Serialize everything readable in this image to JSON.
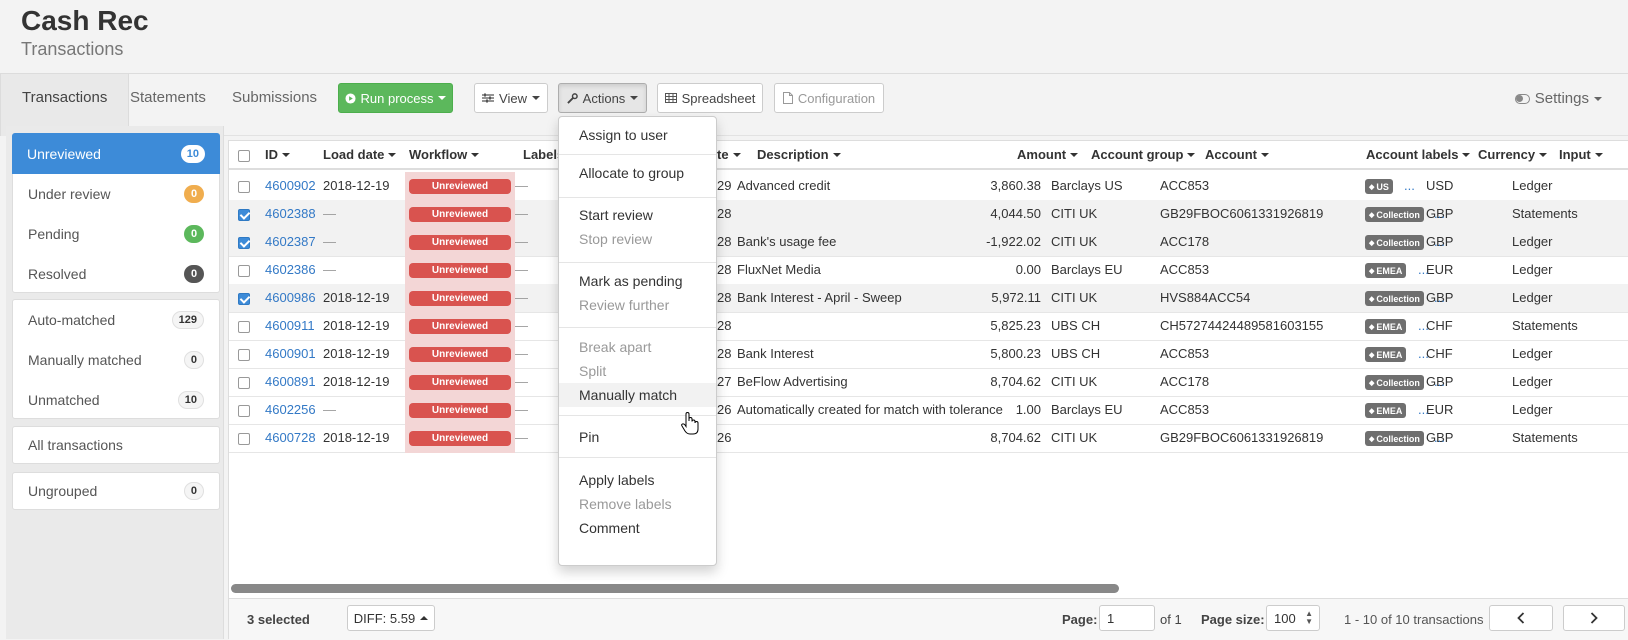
{
  "app": {
    "title": "Cash Rec",
    "subtitle": "Transactions"
  },
  "tabs": [
    {
      "label": "Transactions",
      "active": true
    },
    {
      "label": "Statements"
    },
    {
      "label": "Submissions"
    }
  ],
  "toolbar": {
    "run_process": "Run process",
    "view": "View",
    "actions": "Actions",
    "spreadsheet": "Spreadsheet",
    "configuration": "Configuration",
    "settings": "Settings"
  },
  "sidebar": {
    "status": [
      {
        "label": "Unreviewed",
        "count": "10",
        "color": "#ffffff"
      },
      {
        "label": "Under review",
        "count": "0",
        "color": "#f0ad4e"
      },
      {
        "label": "Pending",
        "count": "0",
        "color": "#5cb85c"
      },
      {
        "label": "Resolved",
        "count": "0",
        "color": "#555555"
      }
    ],
    "match": [
      {
        "label": "Auto-matched",
        "count": "129"
      },
      {
        "label": "Manually matched",
        "count": "0"
      },
      {
        "label": "Unmatched",
        "count": "10"
      }
    ],
    "all": "All transactions",
    "ungrouped": {
      "label": "Ungrouped",
      "count": "0"
    }
  },
  "columns": {
    "id": "ID",
    "load_date": "Load date",
    "workflow": "Workflow",
    "labels": "Labels",
    "date_partial": "te",
    "description": "Description",
    "amount": "Amount",
    "account_group": "Account group",
    "account": "Account",
    "account_labels": "Account labels",
    "currency": "Currency",
    "input": "Input"
  },
  "rows": [
    {
      "id": "4600902",
      "load_date": "2018-12-19",
      "workflow": "Unreviewed",
      "labels": "—",
      "date": "29",
      "description": "Advanced credit",
      "amount": "3,860.38",
      "account_group": "Barclays US",
      "account": "ACC853",
      "account_label": "US",
      "currency": "USD",
      "input": "Ledger",
      "selected": false
    },
    {
      "id": "4602388",
      "load_date": "—",
      "workflow": "Unreviewed",
      "labels": "—",
      "date": "28",
      "description": "",
      "amount": "4,044.50",
      "account_group": "CITI UK",
      "account": "GB29FBOC6061331926819",
      "account_label": "Collection",
      "currency": "GBP",
      "input": "Statements",
      "selected": true
    },
    {
      "id": "4602387",
      "load_date": "—",
      "workflow": "Unreviewed",
      "labels": "—",
      "date": "28",
      "description": "Bank's usage fee",
      "amount": "-1,922.02",
      "account_group": "CITI UK",
      "account": "ACC178",
      "account_label": "Collection",
      "currency": "GBP",
      "input": "Ledger",
      "selected": true
    },
    {
      "id": "4602386",
      "load_date": "—",
      "workflow": "Unreviewed",
      "labels": "—",
      "date": "28",
      "description": "FluxNet Media",
      "amount": "0.00",
      "account_group": "Barclays EU",
      "account": "ACC853",
      "account_label": "EMEA",
      "currency": "EUR",
      "input": "Ledger",
      "selected": false
    },
    {
      "id": "4600986",
      "load_date": "2018-12-19",
      "workflow": "Unreviewed",
      "labels": "—",
      "date": "28",
      "description": "Bank Interest - April - Sweep",
      "amount": "5,972.11",
      "account_group": "CITI UK",
      "account": "HVS884ACC54",
      "account_label": "Collection",
      "currency": "GBP",
      "input": "Ledger",
      "selected": true
    },
    {
      "id": "4600911",
      "load_date": "2018-12-19",
      "workflow": "Unreviewed",
      "labels": "—",
      "date": "28",
      "description": "",
      "amount": "5,825.23",
      "account_group": "UBS CH",
      "account": "CH57274424489581603155",
      "account_label": "EMEA",
      "currency": "CHF",
      "input": "Statements",
      "selected": false
    },
    {
      "id": "4600901",
      "load_date": "2018-12-19",
      "workflow": "Unreviewed",
      "labels": "—",
      "date": "28",
      "description": "Bank Interest",
      "amount": "5,800.23",
      "account_group": "UBS CH",
      "account": "ACC853",
      "account_label": "EMEA",
      "currency": "CHF",
      "input": "Ledger",
      "selected": false
    },
    {
      "id": "4600891",
      "load_date": "2018-12-19",
      "workflow": "Unreviewed",
      "labels": "—",
      "date": "27",
      "description": "BeFlow Advertising",
      "amount": "8,704.62",
      "account_group": "CITI UK",
      "account": "ACC178",
      "account_label": "Collection",
      "currency": "GBP",
      "input": "Ledger",
      "selected": false
    },
    {
      "id": "4602256",
      "load_date": "—",
      "workflow": "Unreviewed",
      "labels": "—",
      "date": "26",
      "description": "Automatically created for match with tolerance",
      "amount": "1.00",
      "account_group": "Barclays EU",
      "account": "ACC853",
      "account_label": "EMEA",
      "currency": "EUR",
      "input": "Ledger",
      "selected": false
    },
    {
      "id": "4600728",
      "load_date": "2018-12-19",
      "workflow": "Unreviewed",
      "labels": "—",
      "date": "26",
      "description": "",
      "amount": "8,704.62",
      "account_group": "CITI UK",
      "account": "GB29FBOC6061331926819",
      "account_label": "Collection",
      "currency": "GBP",
      "input": "Statements",
      "selected": false
    }
  ],
  "footer": {
    "selected": "3 selected",
    "diff": "DIFF: 5.59",
    "page_label": "Page:",
    "page_value": "1",
    "of": "of 1",
    "page_size_label": "Page size:",
    "page_size_value": "100",
    "range": "1 - 10 of 10 transactions"
  },
  "actions_menu": [
    {
      "label": "Assign to user",
      "disabled": false
    },
    {
      "label": "Allocate to group",
      "disabled": false
    },
    {
      "label": "Start review",
      "disabled": false
    },
    {
      "label": "Stop review",
      "disabled": true
    },
    {
      "label": "Mark as pending",
      "disabled": false
    },
    {
      "label": "Review further",
      "disabled": true
    },
    {
      "label": "Break apart",
      "disabled": true
    },
    {
      "label": "Split",
      "disabled": true
    },
    {
      "label": "Manually match",
      "disabled": false,
      "hover": true
    },
    {
      "label": "Pin",
      "disabled": false
    },
    {
      "label": "Apply labels",
      "disabled": false
    },
    {
      "label": "Remove labels",
      "disabled": true
    },
    {
      "label": "Comment",
      "disabled": false
    }
  ],
  "colors": {
    "accent": "#3d8bd8",
    "run_button": "#5cb85c",
    "workflow_pill": "#d9534f",
    "link": "#3379c6"
  }
}
